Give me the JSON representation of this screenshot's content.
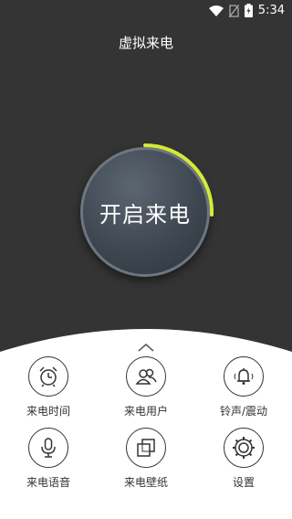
{
  "status_bar": {
    "time": "5:34",
    "icons": [
      "wifi-icon",
      "no-sim-icon",
      "battery-charging-icon"
    ]
  },
  "header": {
    "title": "虚拟来电"
  },
  "dial": {
    "label": "开启来电",
    "accent_color": "#d4ea3a"
  },
  "menu": {
    "items": [
      {
        "label": "来电时间",
        "icon": "alarm-clock-icon"
      },
      {
        "label": "来电用户",
        "icon": "users-icon"
      },
      {
        "label": "铃声/震动",
        "icon": "bell-icon"
      },
      {
        "label": "来电语音",
        "icon": "microphone-icon"
      },
      {
        "label": "来电壁纸",
        "icon": "wallpaper-icon"
      },
      {
        "label": "设置",
        "icon": "gear-icon"
      }
    ]
  }
}
